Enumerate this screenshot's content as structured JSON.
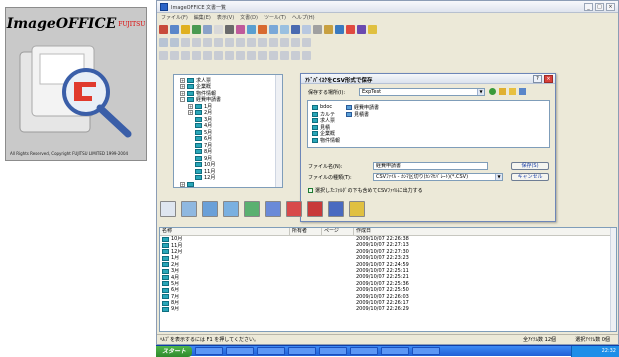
{
  "box": {
    "logo_text": "ImageOFFICE",
    "brand_text": "FUJITSU",
    "copyright": "All Rights Reserved, Copyright FUJITSU LIMITED 1999-2004"
  },
  "window": {
    "title": "ImageOFFICE 文書一覧",
    "menu": [
      "ファイル(F)",
      "編集(E)",
      "表示(V)",
      "文書(D)",
      "ツール(T)",
      "ヘルプ(H)"
    ]
  },
  "tree": {
    "items": [
      {
        "exp": "+",
        "label": "求人票",
        "indent": 0
      },
      {
        "exp": "+",
        "label": "企業概",
        "indent": 0
      },
      {
        "exp": "+",
        "label": "物件情報",
        "indent": 0
      },
      {
        "exp": "-",
        "label": "経費申請書",
        "indent": 0
      },
      {
        "exp": "+",
        "label": "1月",
        "indent": 1
      },
      {
        "exp": "+",
        "label": "2月",
        "indent": 1
      },
      {
        "exp": "",
        "label": "3月",
        "indent": 1
      },
      {
        "exp": "",
        "label": "4月",
        "indent": 1
      },
      {
        "exp": "",
        "label": "5月",
        "indent": 1
      },
      {
        "exp": "",
        "label": "6月",
        "indent": 1
      },
      {
        "exp": "",
        "label": "7月",
        "indent": 1
      },
      {
        "exp": "",
        "label": "8月",
        "indent": 1
      },
      {
        "exp": "",
        "label": "9月",
        "indent": 1
      },
      {
        "exp": "",
        "label": "10月",
        "indent": 1
      },
      {
        "exp": "",
        "label": "11月",
        "indent": 1
      },
      {
        "exp": "",
        "label": "12月",
        "indent": 1
      },
      {
        "exp": "+",
        "label": "",
        "indent": 0
      }
    ]
  },
  "dialog": {
    "title": "ｱﾄﾞﾊﾞｲｽｸをCSV形式で保存",
    "save_in_label": "保存する場所(I):",
    "save_in_value": "ExpTest",
    "files_left": [
      "bdoc",
      "カルテ",
      "求人票",
      "見積",
      "企業概",
      "物件情報"
    ],
    "files_right": [
      "経費申請書",
      "見積書"
    ],
    "filename_label": "ファイル名(N):",
    "filename_value": "経費申請書",
    "filetype_label": "ファイルの種類(T):",
    "filetype_value": "CSVﾌｧｲﾙ - ｶﾝﾏ区切り(ｶﾝﾏｾﾊﾟﾚｰﾄ)(*.CSV)",
    "save_button": "保存(S)",
    "cancel_button": "キャンセル",
    "checkbox_label": "選択したﾌｫﾙﾀﾞの下も含めてCSVﾌｧｲﾙに出力する"
  },
  "list": {
    "headers": [
      "名称",
      "所有者",
      "ページ",
      "作成日"
    ],
    "rows": [
      {
        "name": "10月",
        "date": "2009/10/07 22:26:38"
      },
      {
        "name": "11月",
        "date": "2009/10/07 22:27:13"
      },
      {
        "name": "12月",
        "date": "2009/10/07 22:27:30"
      },
      {
        "name": "1月",
        "date": "2009/10/07 22:23:23"
      },
      {
        "name": "2月",
        "date": "2009/10/07 22:24:59"
      },
      {
        "name": "3月",
        "date": "2009/10/07 22:25:11"
      },
      {
        "name": "4月",
        "date": "2009/10/07 22:25:21"
      },
      {
        "name": "5月",
        "date": "2009/10/07 22:25:36"
      },
      {
        "name": "6月",
        "date": "2009/10/07 22:25:50"
      },
      {
        "name": "7月",
        "date": "2009/10/07 22:26:03"
      },
      {
        "name": "8月",
        "date": "2009/10/07 22:26:17"
      },
      {
        "name": "9月",
        "date": "2009/10/07 22:26:29"
      }
    ]
  },
  "status": {
    "help": "ﾍﾙﾌﾟを表示するには F1 を押してください。",
    "total": "全ｱｲﾃﾑ数 12個",
    "selected": "選択ｱｲﾃﾑ数 0個"
  },
  "taskbar": {
    "start": "スタート",
    "clock": "22:32"
  },
  "colors": {
    "folder": "#2aa6b8",
    "accent": "#d8403a",
    "taskbar": "#1f5fd6"
  }
}
